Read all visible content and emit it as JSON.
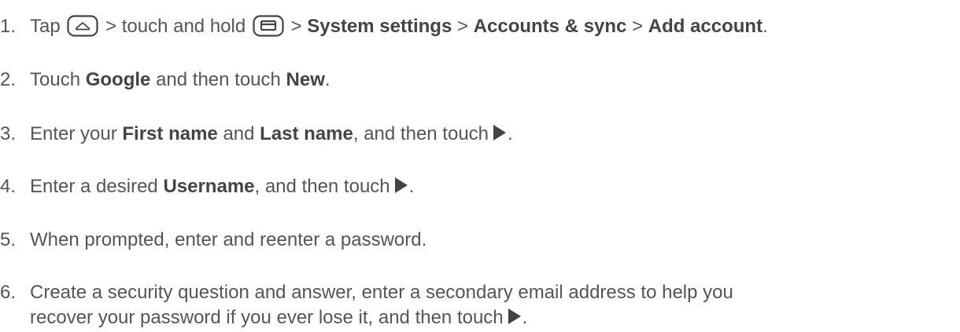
{
  "steps": [
    {
      "num": "1.",
      "parts": {
        "t1": "Tap",
        "t2": "> touch and hold",
        "t3": ">",
        "b1": "System settings",
        "t4": ">",
        "b2": "Accounts & sync",
        "t5": ">",
        "b3": "Add account",
        "t6": "."
      },
      "icons": [
        "home-key-icon",
        "recent-apps-key-icon"
      ]
    },
    {
      "num": "2.",
      "parts": {
        "t1": "Touch",
        "b1": "Google",
        "t2": "and then touch",
        "b2": "New",
        "t3": "."
      }
    },
    {
      "num": "3.",
      "parts": {
        "t1": "Enter your",
        "b1": "First name",
        "t2": "and",
        "b2": "Last name",
        "t3": ", and then touch",
        "t4": "."
      },
      "icons": [
        "next-arrow-icon"
      ]
    },
    {
      "num": "4.",
      "parts": {
        "t1": "Enter a desired",
        "b1": "Username",
        "t2": ", and then touch",
        "t3": "."
      },
      "icons": [
        "next-arrow-icon"
      ]
    },
    {
      "num": "5.",
      "parts": {
        "t1": "When prompted, enter and reenter a password."
      }
    },
    {
      "num": "6.",
      "parts": {
        "t1": "Create a security question and answer, enter a secondary email address to help you",
        "t2": "recover your password if you ever lose it, and then touch",
        "t3": "."
      },
      "icons": [
        "next-arrow-icon"
      ]
    }
  ],
  "colors": {
    "text": "#555555",
    "bold": "#444444",
    "icon": "#444444"
  }
}
